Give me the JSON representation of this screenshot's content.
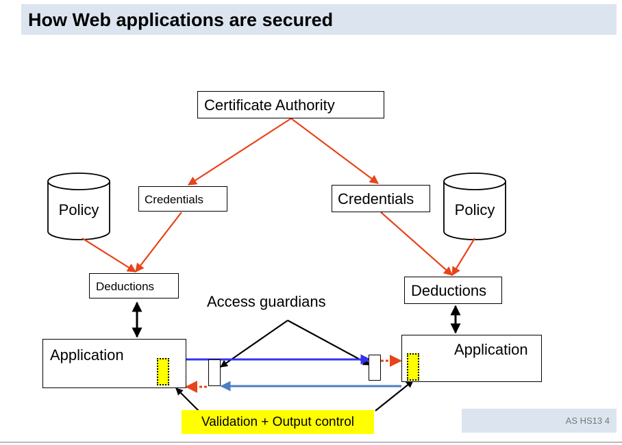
{
  "slide": {
    "title": "How Web applications are secured",
    "footer": "AS HS13 4"
  },
  "diagram": {
    "certificate_authority": "Certificate Authority",
    "credentials_left": "Credentials",
    "credentials_right": "Credentials",
    "policy_left": "Policy",
    "policy_right": "Policy",
    "deductions_left": "Deductions",
    "deductions_right": "Deductions",
    "access_guardians": "Access guardians",
    "application_left": "Application",
    "application_right": "Application",
    "validation": "Validation + Output control"
  },
  "colors": {
    "trust_arrow": "#e8431a",
    "request_arrow": "#3333ee",
    "response_arrow": "#4a7ec4",
    "validation_highlight": "#ffff00",
    "title_bar": "#dce5ef"
  }
}
